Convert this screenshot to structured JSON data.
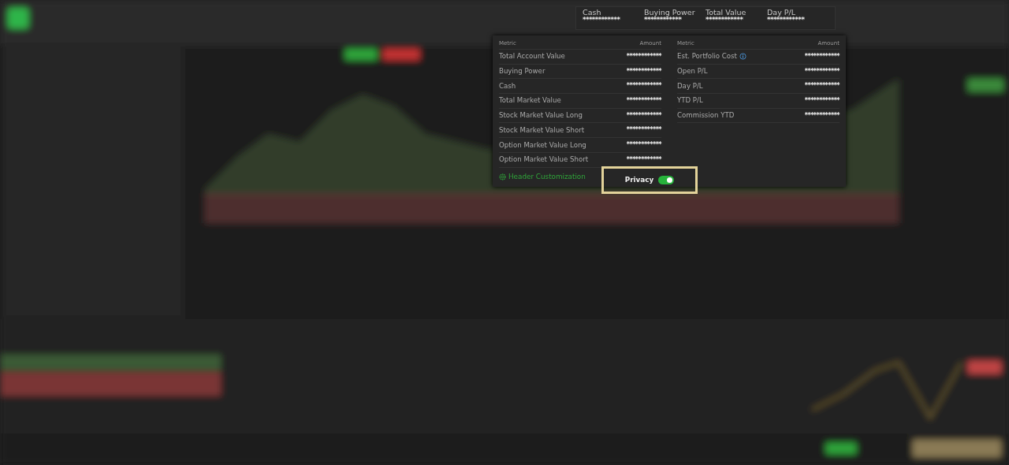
{
  "header_stats": [
    {
      "label": "Cash",
      "value": "************"
    },
    {
      "label": "Buying Power",
      "value": "************"
    },
    {
      "label": "Total Value",
      "value": "************"
    },
    {
      "label": "Day P/L",
      "value": "************"
    }
  ],
  "summary": [
    {
      "columns": [
        "Metric",
        "Amount"
      ],
      "rows": [
        {
          "metric": "Total Account Value",
          "amount": "************",
          "info_icon": false
        },
        {
          "metric": "Buying Power",
          "amount": "************",
          "info_icon": false
        },
        {
          "metric": "Cash",
          "amount": "************",
          "info_icon": false
        },
        {
          "metric": "Total Market Value",
          "amount": "************",
          "info_icon": false
        },
        {
          "metric": "Stock Market Value Long",
          "amount": "************",
          "info_icon": false
        },
        {
          "metric": "Stock Market Value Short",
          "amount": "************",
          "info_icon": false
        },
        {
          "metric": "Option Market Value Long",
          "amount": "************",
          "info_icon": false
        },
        {
          "metric": "Option Market Value Short",
          "amount": "************",
          "info_icon": false
        }
      ]
    },
    {
      "columns": [
        "Metric",
        "Amount"
      ],
      "rows": [
        {
          "metric": "Est. Portfolio Cost",
          "amount": "************",
          "info_icon": true
        },
        {
          "metric": "Open P/L",
          "amount": "************",
          "info_icon": false
        },
        {
          "metric": "Day P/L",
          "amount": "************",
          "info_icon": false
        },
        {
          "metric": "YTD P/L",
          "amount": "************",
          "info_icon": false
        },
        {
          "metric": "Commission YTD",
          "amount": "************",
          "info_icon": false
        }
      ]
    }
  ],
  "header_customization": {
    "label": "Header Customization"
  },
  "privacy": {
    "label": "Privacy",
    "on": true,
    "highlighted": true
  }
}
